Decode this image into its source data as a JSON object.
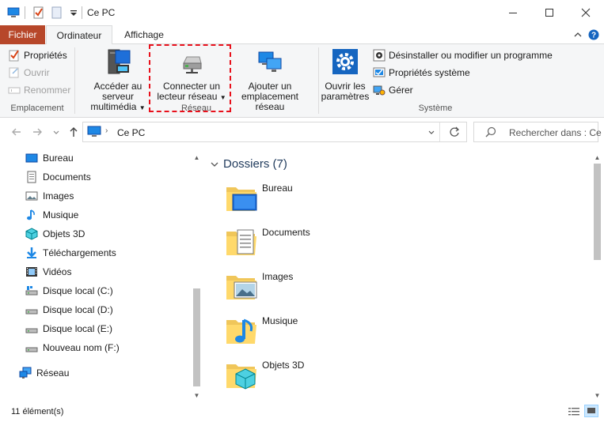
{
  "window": {
    "title": "Ce PC"
  },
  "ribbon_tabs": {
    "file": "Fichier",
    "computer": "Ordinateur",
    "view": "Affichage"
  },
  "ribbon": {
    "location": {
      "properties": "Propriétés",
      "open": "Ouvrir",
      "rename": "Renommer",
      "group_label": "Emplacement"
    },
    "network": {
      "media_server_line1": "Accéder au serveur",
      "media_server_line2": "multimédia",
      "map_drive_line1": "Connecter un",
      "map_drive_line2": "lecteur réseau",
      "add_location_line1": "Ajouter un",
      "add_location_line2": "emplacement réseau",
      "group_label": "Réseau"
    },
    "system": {
      "open_settings_line1": "Ouvrir les",
      "open_settings_line2": "paramètres",
      "uninstall": "Désinstaller ou modifier un programme",
      "system_properties": "Propriétés système",
      "manage": "Gérer",
      "group_label": "Système"
    }
  },
  "address": {
    "path": "Ce PC",
    "search_placeholder": "Rechercher dans : Ce PC"
  },
  "nav_pane": {
    "items": [
      {
        "label": "Bureau",
        "icon": "desktop-icon"
      },
      {
        "label": "Documents",
        "icon": "documents-icon"
      },
      {
        "label": "Images",
        "icon": "images-icon"
      },
      {
        "label": "Musique",
        "icon": "music-icon"
      },
      {
        "label": "Objets 3D",
        "icon": "objects-3d-icon"
      },
      {
        "label": "Téléchargements",
        "icon": "downloads-icon"
      },
      {
        "label": "Vidéos",
        "icon": "videos-icon"
      },
      {
        "label": "Disque local (C:)",
        "icon": "system-drive-icon"
      },
      {
        "label": "Disque local (D:)",
        "icon": "drive-icon"
      },
      {
        "label": "Disque local (E:)",
        "icon": "drive-icon"
      },
      {
        "label": "Nouveau nom (F:)",
        "icon": "drive-icon"
      }
    ],
    "network": "Réseau"
  },
  "content": {
    "group_title": "Dossiers (7)",
    "folders": [
      {
        "label": "Bureau",
        "icon": "desktop-folder-icon"
      },
      {
        "label": "Documents",
        "icon": "documents-folder-icon"
      },
      {
        "label": "Images",
        "icon": "images-folder-icon"
      },
      {
        "label": "Musique",
        "icon": "music-folder-icon"
      },
      {
        "label": "Objets 3D",
        "icon": "objects-3d-folder-icon"
      }
    ]
  },
  "status": {
    "item_count": "11 élément(s)"
  },
  "colors": {
    "file_tab": "#b7472a",
    "highlight_border": "#e8101b",
    "group_header": "#1e395b",
    "ribbon_bg": "#f5f6f7"
  }
}
